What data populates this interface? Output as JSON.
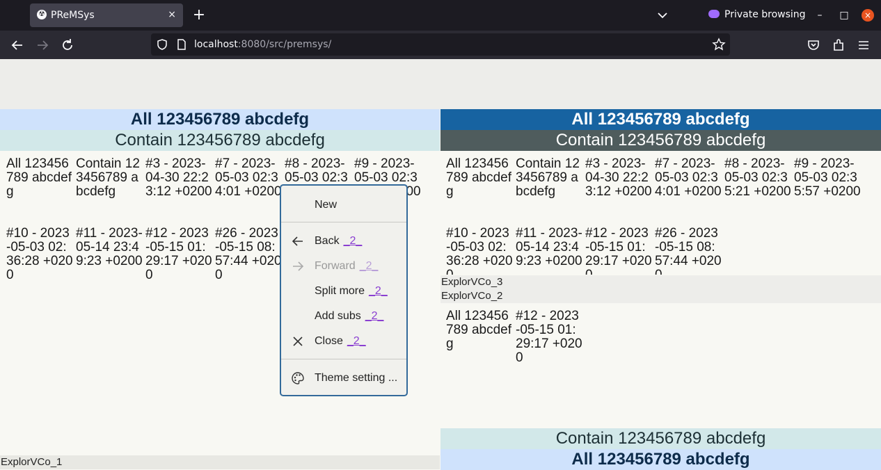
{
  "browser": {
    "tab_title": "PReMSys",
    "tab_close": "×",
    "new_tab": "+",
    "private_label": "Private browsing",
    "url_host": "localhost",
    "url_rest": ":8080/src/premsys/",
    "minimize": "–",
    "maximize": "□",
    "close": "×"
  },
  "left_pane": {
    "bars": [
      {
        "label": "All 123456789 abcdefg",
        "bg": "#cfe2fc",
        "color": "#0d2b4a"
      },
      {
        "label": "Contain 123456789 abcdefg",
        "bg": "#d2e8e9",
        "color": "#1c2f34"
      }
    ],
    "cells_row1": [
      "All 123456789 abcdefg",
      "Contain 123456789 abcdefg",
      "#3 - 2023-04-30 22:23:12 +0200",
      "#7 - 2023-05-03 02:34:01 +0200",
      "#8 - 2023-05-03 02:35:21 +0200",
      "#9 - 2023-05-03 02:35:57 +0200"
    ],
    "cells_row2": [
      "#10 - 2023-05-03 02:36:28 +0200",
      "#11 - 2023-05-14 23:49:23 +0200",
      "#12 - 2023-05-15 01:29:17 +0200",
      "#26 - 2023-05-15 08:57:44 +0200"
    ],
    "footer_label": "ExplorVCo_1"
  },
  "right_pane": {
    "bars_top": [
      {
        "label": "All 123456789 abcdefg",
        "bg": "#1763a1",
        "color": "#ffffff"
      },
      {
        "label": "Contain 123456789 abcdefg",
        "bg": "#4f5c5d",
        "color": "#ffffff"
      }
    ],
    "cells_row1": [
      "All 123456789 abcdefg",
      "Contain 123456789 abcdefg",
      "#3 - 2023-04-30 22:23:12 +0200",
      "#7 - 2023-05-03 02:34:01 +0200",
      "#8 - 2023-05-03 02:35:21 +0200",
      "#9 - 2023-05-03 02:35:57 +0200"
    ],
    "cells_row2": [
      "#10 - 2023-05-03 02:36:28 +0200",
      "#11 - 2023-05-14 23:49:23 +0200",
      "#12 - 2023-05-15 01:29:17 +0200",
      "#26 - 2023-05-15 08:57:44 +0200"
    ],
    "label_a": "ExplorVCo_3",
    "label_b": "ExplorVCo_2",
    "cells_row3": [
      "All 123456789 abcdefg",
      "#12 - 2023-05-15 01:29:17 +0200"
    ],
    "bars_bottom": [
      {
        "label": "Contain 123456789 abcdefg",
        "bg": "#d2e8e9",
        "color": "#1c2f34"
      },
      {
        "label": "All 123456789 abcdefg",
        "bg": "#cfe2fc",
        "color": "#0d2b4a"
      }
    ]
  },
  "context_menu": {
    "new": "New",
    "back": "Back",
    "forward": "Forward",
    "split_more": "Split more",
    "add_subs": "Add subs",
    "close": "Close",
    "theme": "Theme setting ...",
    "accel": "_2_"
  }
}
